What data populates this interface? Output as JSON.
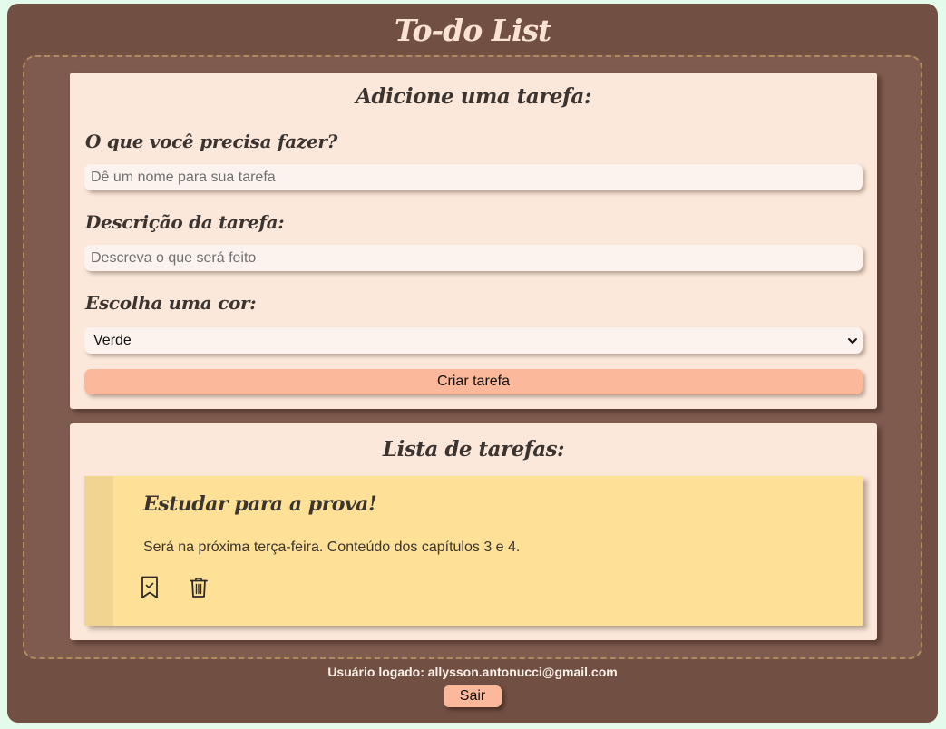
{
  "app": {
    "title": "To-do List"
  },
  "form": {
    "heading": "Adicione uma tarefa:",
    "name_label": "O que você precisa fazer?",
    "name_placeholder": "Dê um nome para sua tarefa",
    "name_value": "",
    "description_label": "Descrição da tarefa:",
    "description_placeholder": "Descreva o que será feito",
    "description_value": "",
    "color_label": "Escolha uma cor:",
    "color_selected": "Verde",
    "submit_label": "Criar tarefa"
  },
  "list": {
    "heading": "Lista de tarefas:",
    "tasks": [
      {
        "title": "Estudar para a prova!",
        "description": "Será na próxima terça-feira. Conteúdo dos capítulos 3 e 4.",
        "color": "#fee196",
        "icons": [
          "bookmark-check-icon",
          "trash-icon"
        ]
      }
    ]
  },
  "footer": {
    "user_text": "Usuário logado: allysson.antonucci@gmail.com",
    "logout_label": "Sair"
  },
  "colors": {
    "page_background": "#e3fbea",
    "app_background": "#724f43",
    "board_background": "#7f5b4f",
    "card_background": "#fce8da",
    "accent": "#fbb89a",
    "title_text": "#fbe3d3"
  }
}
